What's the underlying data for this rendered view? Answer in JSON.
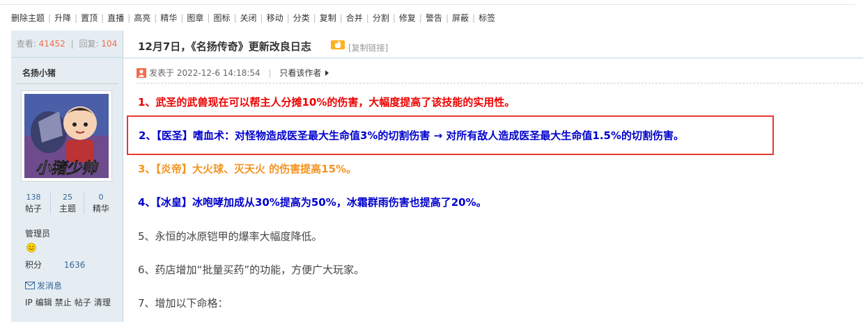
{
  "modbar": {
    "actions": [
      "删除主题",
      "升降",
      "置顶",
      "直播",
      "高亮",
      "精华",
      "图章",
      "图标",
      "关闭",
      "移动",
      "分类",
      "复制",
      "合并",
      "分割",
      "修复",
      "警告",
      "屏蔽",
      "标签"
    ],
    "separator": "|"
  },
  "sidebar": {
    "views_label": "查看:",
    "views_value": "41452",
    "sep": "|",
    "replies_label": "回复:",
    "replies_value": "104",
    "author_name": "名扬小猪",
    "avatar_text": "小猪少帅",
    "stats": [
      {
        "value": "138",
        "label": "帖子"
      },
      {
        "value": "25",
        "label": "主题"
      },
      {
        "value": "0",
        "label": "精华"
      }
    ],
    "group": "管理员",
    "group_icon": "smiley-icon",
    "points_label": "积分",
    "points_value": "1636",
    "send_message": "发消息",
    "admin_links": [
      "IP",
      "编辑",
      "禁止",
      "帖子",
      "清理"
    ]
  },
  "post": {
    "title": "12月7日，《名扬传奇》更新改良日志",
    "copy_link": "[复制链接]",
    "posted_label": "发表于",
    "posted_time": "2022-12-6 14:18:54",
    "meta_sep": "|",
    "only_author": "只看该作者",
    "lines": [
      "1、武圣的武兽现在可以帮主人分摊10%的伤害，大幅度提高了该技能的实用性。",
      "2、【医圣】嗜血术：对怪物造成医圣最大生命值3%的切割伤害 → 对所有敌人造成医圣最大生命值1.5%的切割伤害。",
      "3、【炎帝】大火球、灭天火 的伤害提高15%。",
      "4、【冰皇】冰咆哮加成从30%提高为50%，冰霜群雨伤害也提高了20%。",
      "5、永恒的冰原铠甲的爆率大幅度降低。",
      "6、药店增加“批量买药”的功能，方便广大玩家。",
      "7、增加以下命格："
    ]
  },
  "colors": {
    "line1": "#e00000",
    "line2": "#0000cc",
    "line3": "#f49420",
    "line4": "#0000cc",
    "highlight_box": "#e53935",
    "sidebar_bg": "#e5edf2"
  }
}
